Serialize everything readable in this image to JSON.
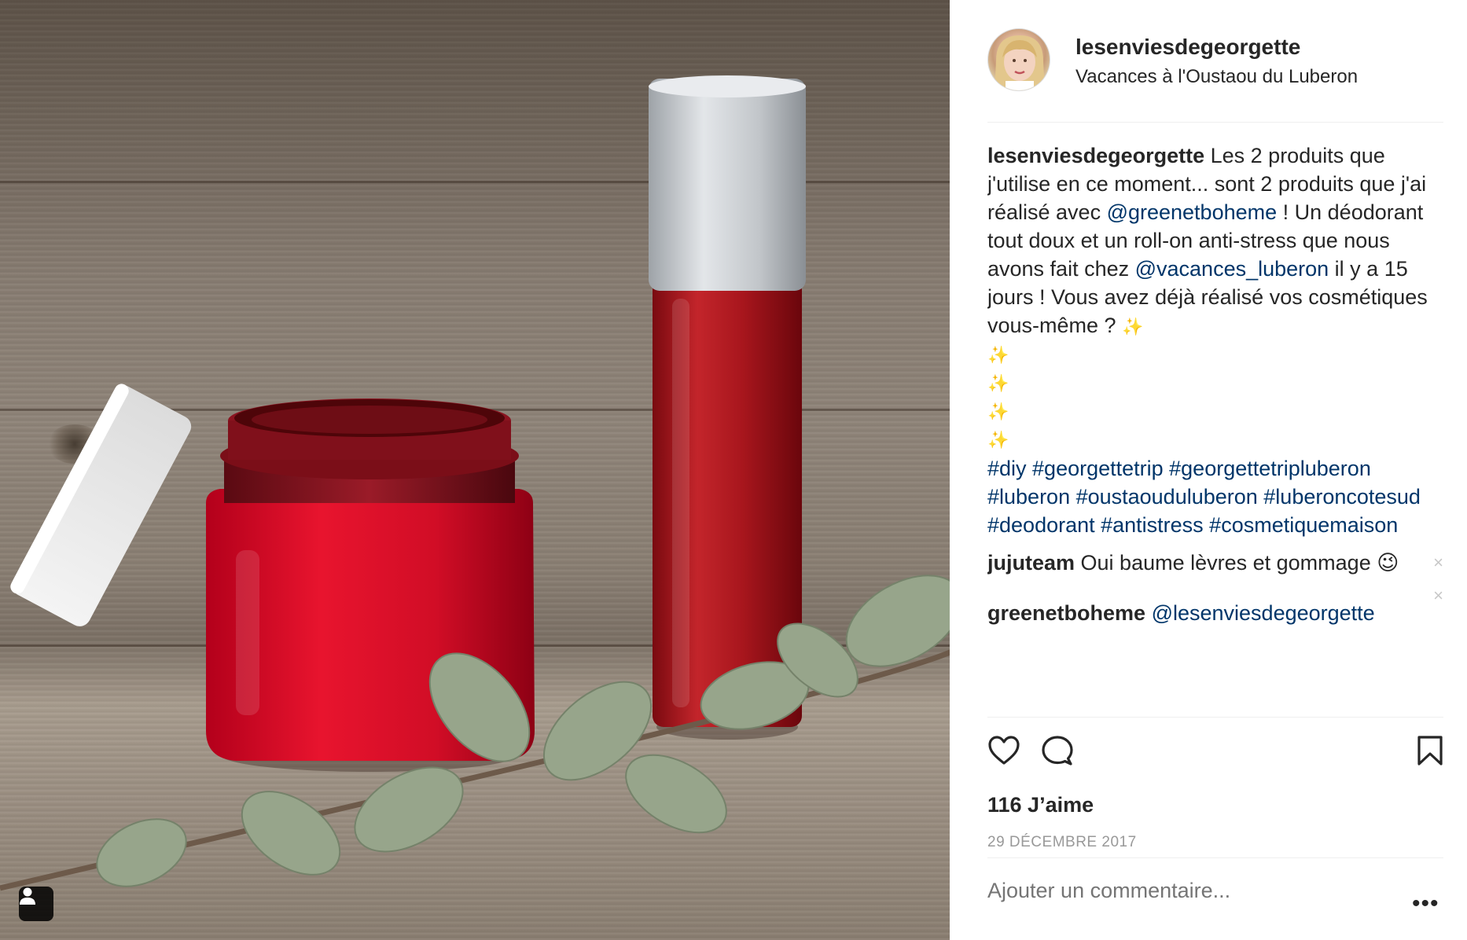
{
  "post": {
    "username": "lesenviesdegeorgette",
    "location": "Vacances à l'Oustaou du Luberon",
    "likes": "116 J’aime",
    "date": "29 DÉCEMBRE 2017",
    "comment_placeholder": "Ajouter un commentaire...",
    "more": "•••"
  },
  "caption": {
    "author": "lesenviesdegeorgette",
    "text1": " Les 2 produits que j'utilise en ce moment... sont 2 produits que j'ai réalisé avec ",
    "mention1": "@greenetboheme",
    "text2": " ! Un déodorant tout doux et un roll-on anti-stress que nous avons fait chez ",
    "mention2": "@vacances_luberon",
    "text3": " il y a 15 jours ! Vous avez déjà réalisé vos cosmétiques vous-même ? ",
    "spark": "✨",
    "hashtags": "#diy #georgettetrip #georgettetripluberon #luberon #oustaouduluberon #luberoncotesud #deodorant #antistress #cosmetiquemaison"
  },
  "comments": [
    {
      "author": "jujuteam",
      "text": " Oui baume lèvres et gommage ",
      "emoji": "😉",
      "close": "×"
    },
    {
      "author": "greenetboheme",
      "text": " ",
      "mention": "@lesenviesdegeorgette",
      "close": "×"
    }
  ],
  "icons": {
    "like": "heart-icon",
    "comment": "comment-icon",
    "save": "bookmark-icon",
    "user_tag": "user-icon"
  },
  "colors": {
    "link": "#003569",
    "text": "#262626",
    "muted": "#999999",
    "divider": "#efefef"
  }
}
